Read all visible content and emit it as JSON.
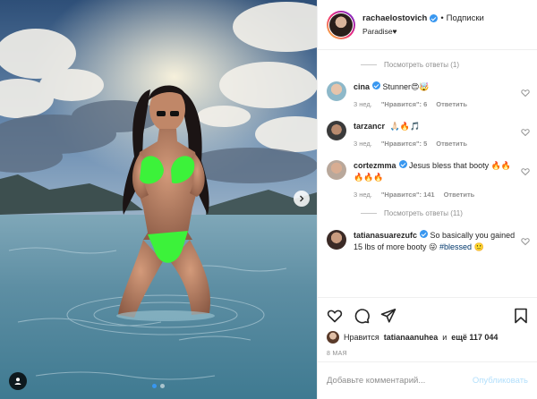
{
  "post": {
    "username": "rachaelostovich",
    "separator": "•",
    "follow_label": "Подписки",
    "location": "Paradise♥",
    "more_icon": "more-horizontal-icon"
  },
  "carousel": {
    "slides": 2,
    "active_index": 0
  },
  "comments": {
    "view_replies_top": "Посмотреть ответы (1)",
    "items": [
      {
        "username": "cina",
        "text": "Stunner😍🤯",
        "age": "3 нед.",
        "likes": "\"Нравится\": 6",
        "reply": "Ответить"
      },
      {
        "username": "tarzancr",
        "text": "🙏🏻🔥🎵",
        "age": "3 нед.",
        "likes": "\"Нравится\": 5",
        "reply": "Ответить"
      },
      {
        "username": "cortezmma",
        "text": "Jesus bless that booty 🔥🔥🔥🔥🔥",
        "age": "3 нед.",
        "likes": "\"Нравится\": 141",
        "reply": "Ответить"
      }
    ],
    "view_replies_mid": "Посмотреть ответы (11)",
    "last": {
      "username": "tatianasuarezufc",
      "text": "So basically you gained 15 lbs of more booty 😜",
      "hashtag": "#blessed",
      "emoji": "🙂"
    }
  },
  "likes": {
    "prefix": "Нравится",
    "user": "tatianaanuhea",
    "conj": "и",
    "rest": "ещё 117 044"
  },
  "date": "8 МАЯ",
  "composer": {
    "placeholder": "Добавьте комментарий...",
    "publish_label": "Опубликовать"
  },
  "colors": {
    "accent": "#3897f0",
    "bikini": "#3cf23a",
    "publish_disabled": "#b2dffc"
  }
}
